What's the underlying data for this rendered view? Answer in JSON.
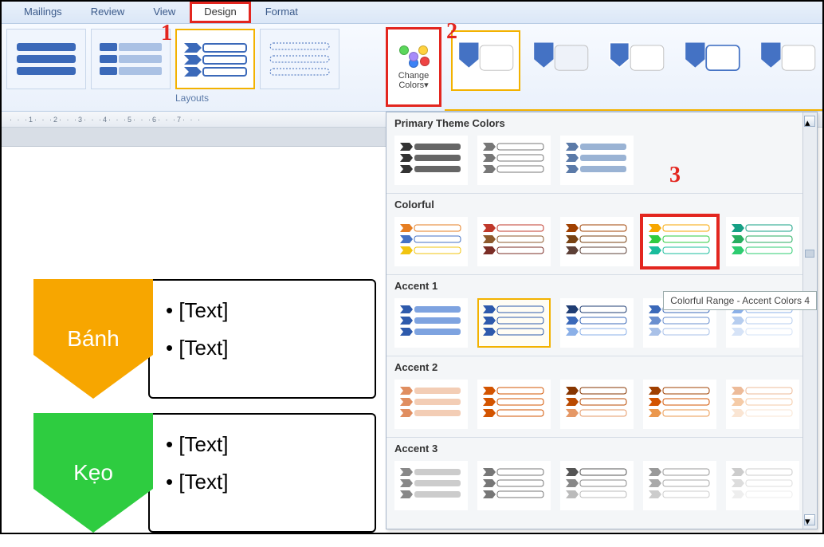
{
  "tabs": [
    "Mailings",
    "Review",
    "View",
    "Design",
    "Format"
  ],
  "active_tab_index": 3,
  "ribbon": {
    "layouts_label": "Layouts",
    "change_colors_label": "Change Colors▾"
  },
  "annotations": {
    "a1": "1",
    "a2": "2",
    "a3": "3"
  },
  "dropdown": {
    "sections": [
      "Primary Theme Colors",
      "Colorful",
      "Accent 1",
      "Accent 2",
      "Accent 3"
    ],
    "tooltip": "Colorful Range - Accent Colors 4"
  },
  "smartart": {
    "rows": [
      {
        "label": "Bánh",
        "color": "#f7a600",
        "bullets": [
          "• [Text]",
          "• [Text]"
        ]
      },
      {
        "label": "Kẹo",
        "color": "#2ecc40",
        "bullets": [
          "• [Text]",
          "• [Text]"
        ]
      }
    ]
  },
  "ruler_text": "· · ·1· · ·2· · ·3· · ·4· · ·5· · ·6· · ·7· · ·"
}
